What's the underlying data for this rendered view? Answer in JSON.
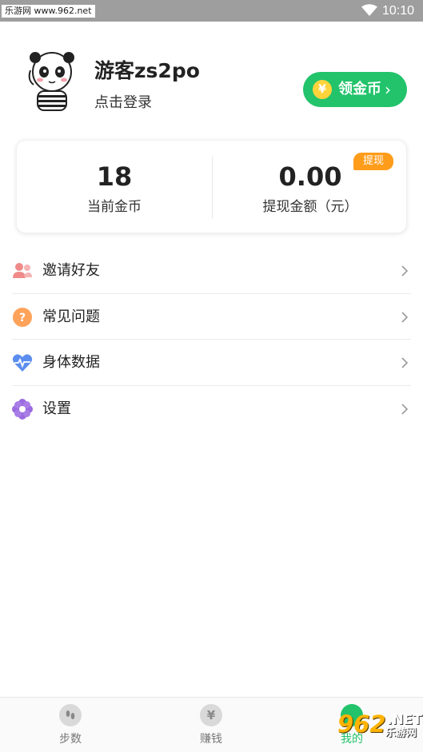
{
  "status_bar": {
    "watermark": "乐游网 www.962.net",
    "time": "10:10",
    "icons": [
      "wifi-icon"
    ]
  },
  "profile": {
    "avatar_icon": "panda-avatar-icon",
    "username": "游客zs2po",
    "login_link": "点击登录",
    "coin_button": {
      "icon": "¥",
      "label": "领金币",
      "chevron": "›"
    }
  },
  "stats": {
    "coins": {
      "value": "18",
      "label": "当前金币"
    },
    "withdraw_amount": {
      "value": "0.00",
      "label": "提现金额（元）"
    },
    "withdraw_badge": "提现"
  },
  "menu": {
    "items": [
      {
        "label": "邀请好友",
        "icon": "invite-friends-icon",
        "color": "#f08a8a"
      },
      {
        "label": "常见问题",
        "icon": "faq-icon",
        "color": "#ffa25a"
      },
      {
        "label": "身体数据",
        "icon": "heart-pulse-icon",
        "color": "#5b8def"
      },
      {
        "label": "设置",
        "icon": "settings-flower-icon",
        "color": "#9b6be0"
      }
    ]
  },
  "bottom_nav": {
    "items": [
      {
        "label": "步数",
        "icon": "footsteps-icon",
        "glyph": "👣"
      },
      {
        "label": "赚钱",
        "icon": "yen-icon",
        "glyph": "¥"
      },
      {
        "label": "我的",
        "icon": "profile-icon",
        "glyph": "",
        "active": true
      }
    ]
  },
  "watermark_bottom": {
    "num": "962",
    "net": ".NET",
    "cn": "乐游网"
  },
  "colors": {
    "accent_green": "#22c36b",
    "badge_orange": "#ff9d1b",
    "status_bar": "#9e9e9e"
  }
}
